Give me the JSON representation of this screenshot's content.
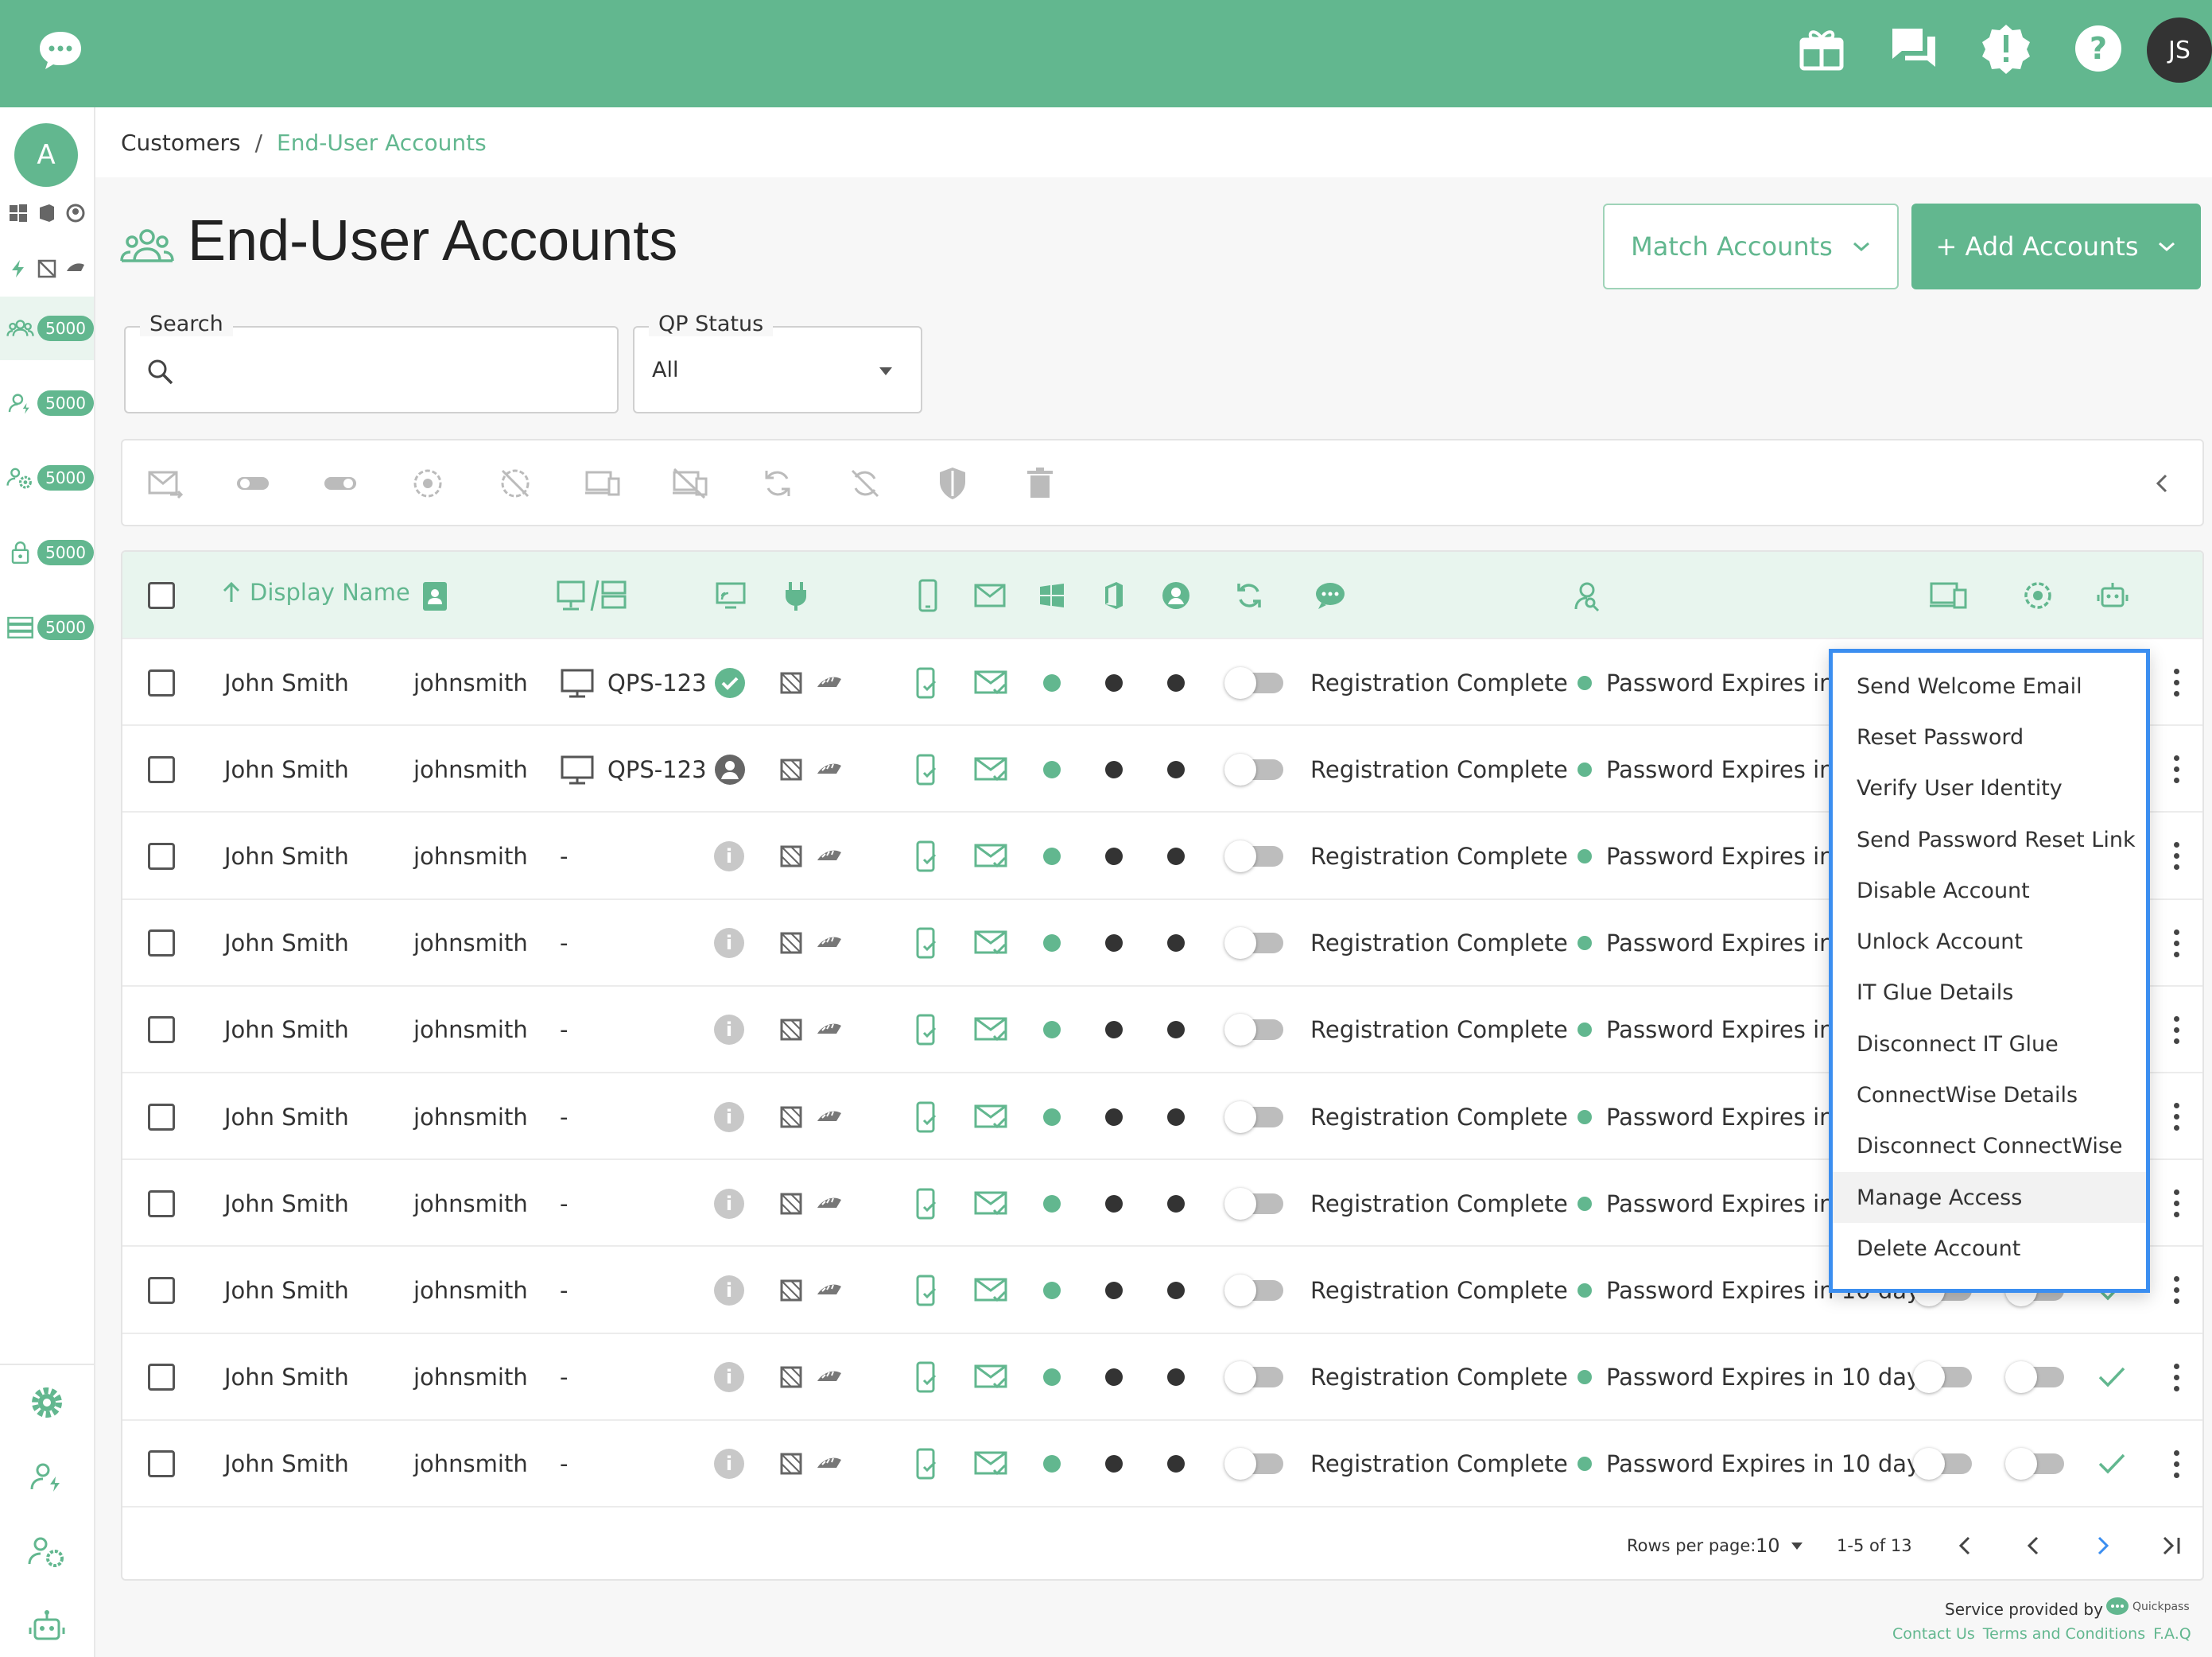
{
  "app": {
    "user_initials": "JS",
    "org_initial": "A"
  },
  "colors": {
    "brand": "#62b78f",
    "menu_border": "#3b8ef0"
  },
  "sidebar": {
    "counts": [
      {
        "icon": "users-icon",
        "count": "5000"
      },
      {
        "icon": "user-lightning-icon",
        "count": "5000"
      },
      {
        "icon": "user-gear-icon",
        "count": "5000"
      },
      {
        "icon": "lock-icon",
        "count": "5000"
      },
      {
        "icon": "server-icon",
        "count": "5000"
      }
    ]
  },
  "breadcrumb": {
    "parent": "Customers",
    "separator": "/",
    "current": "End-User Accounts"
  },
  "page": {
    "title": "End-User Accounts"
  },
  "buttons": {
    "match_accounts": "Match Accounts",
    "add_accounts": "+ Add Accounts"
  },
  "filters": {
    "search_label": "Search",
    "search_value": "",
    "status_label": "QP Status",
    "status_value": "All"
  },
  "table": {
    "header": {
      "display_name": "Display Name"
    },
    "rows": [
      {
        "name": "John Smith",
        "username": "johnsmith",
        "computer": "QPS-123",
        "status": "Registration Complete",
        "password": "Password Expires in 10 days",
        "qp_icon": "check"
      },
      {
        "name": "John Smith",
        "username": "johnsmith",
        "computer": "QPS-123",
        "status": "Registration Complete",
        "password": "Password Expires in 10 days",
        "qp_icon": "user"
      },
      {
        "name": "John Smith",
        "username": "johnsmith",
        "computer": "-",
        "status": "Registration Complete",
        "password": "Password Expires in 10 days",
        "qp_icon": "info"
      },
      {
        "name": "John Smith",
        "username": "johnsmith",
        "computer": "-",
        "status": "Registration Complete",
        "password": "Password Expires in 10 days",
        "qp_icon": "info"
      },
      {
        "name": "John Smith",
        "username": "johnsmith",
        "computer": "-",
        "status": "Registration Complete",
        "password": "Password Expires in 10 days",
        "qp_icon": "info"
      },
      {
        "name": "John Smith",
        "username": "johnsmith",
        "computer": "-",
        "status": "Registration Complete",
        "password": "Password Expires in 10 days",
        "qp_icon": "info"
      },
      {
        "name": "John Smith",
        "username": "johnsmith",
        "computer": "-",
        "status": "Registration Complete",
        "password": "Password Expires in 10 days",
        "qp_icon": "info"
      },
      {
        "name": "John Smith",
        "username": "johnsmith",
        "computer": "-",
        "status": "Registration Complete",
        "password": "Password Expires in 10 days",
        "qp_icon": "info"
      },
      {
        "name": "John Smith",
        "username": "johnsmith",
        "computer": "-",
        "status": "Registration Complete",
        "password": "Password Expires in 10 days",
        "qp_icon": "info"
      },
      {
        "name": "John Smith",
        "username": "johnsmith",
        "computer": "-",
        "status": "Registration Complete",
        "password": "Password Expires in 10 days",
        "qp_icon": "info"
      }
    ]
  },
  "pagination": {
    "rows_per_page_label": "Rows per page:",
    "rows_per_page": "10",
    "range": "1-5 of 13"
  },
  "context_menu": {
    "items": [
      "Send Welcome Email",
      "Reset Password",
      "Verify User Identity",
      "Send Password Reset Link",
      "Disable Account",
      "Unlock Account",
      "IT Glue Details",
      "Disconnect IT Glue",
      "ConnectWise Details",
      "Disconnect ConnectWise",
      "Manage Access",
      "Delete Account"
    ],
    "highlighted": "Manage Access"
  },
  "footer": {
    "service_label": "Service provided by",
    "logo_text": "Quickpass",
    "links": [
      "Contact Us",
      "Terms and Conditions",
      "F.A.Q"
    ]
  }
}
